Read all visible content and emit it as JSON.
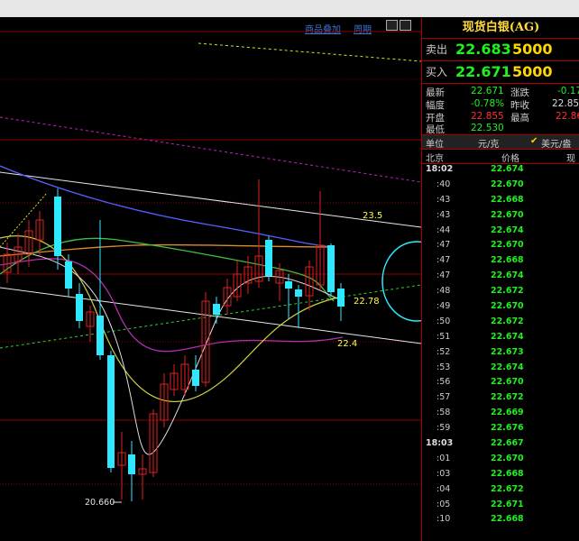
{
  "toolbar": {
    "overlay_label": "商品叠加",
    "period_label": "周期"
  },
  "chart": {
    "annotations": [
      {
        "text": "23.5",
        "color": "#ffff40"
      },
      {
        "text": "22.78",
        "color": "#ffff40"
      },
      {
        "text": "22.4",
        "color": "#ffff40"
      },
      {
        "text": "20.660",
        "color": "#e0e0e0"
      }
    ]
  },
  "panel": {
    "title": "现货白银(AG)",
    "sell": {
      "label": "卖出",
      "price": "22.683",
      "volume": "5000"
    },
    "buy": {
      "label": "买入",
      "price": "22.671",
      "volume": "5000"
    },
    "stats": {
      "latest_label": "最新",
      "latest": "22.671",
      "change_label": "涨跌",
      "change": "-0.17",
      "amplitude_label": "幅度",
      "amplitude": "-0.78%",
      "prev_close_label": "昨收",
      "prev_close": "22.85",
      "open_label": "开盘",
      "open": "22.855",
      "high_label": "最高",
      "high": "22.86",
      "low_label": "最低",
      "low": "22.530"
    },
    "unit_row": {
      "unit_label": "单位",
      "unit": "元/克",
      "alt_unit": "美元/盎"
    },
    "tick_header": {
      "time": "北京",
      "price": "价格",
      "vol": "现"
    },
    "ticks": [
      {
        "time": "18:02",
        "price": "22.674"
      },
      {
        "time": ":40",
        "price": "22.670"
      },
      {
        "time": ":43",
        "price": "22.668"
      },
      {
        "time": ":43",
        "price": "22.670"
      },
      {
        "time": ":44",
        "price": "22.674"
      },
      {
        "time": ":47",
        "price": "22.670"
      },
      {
        "time": ":47",
        "price": "22.668"
      },
      {
        "time": ":47",
        "price": "22.674"
      },
      {
        "time": ":48",
        "price": "22.672"
      },
      {
        "time": ":49",
        "price": "22.670"
      },
      {
        "time": ":50",
        "price": "22.672"
      },
      {
        "time": ":51",
        "price": "22.674"
      },
      {
        "time": ":52",
        "price": "22.673"
      },
      {
        "time": ":53",
        "price": "22.674"
      },
      {
        "time": ":56",
        "price": "22.670"
      },
      {
        "time": ":57",
        "price": "22.672"
      },
      {
        "time": ":58",
        "price": "22.669"
      },
      {
        "time": ":59",
        "price": "22.676"
      },
      {
        "time": "18:03",
        "price": "22.667"
      },
      {
        "time": ":01",
        "price": "22.670"
      },
      {
        "time": ":03",
        "price": "22.668"
      },
      {
        "time": ":04",
        "price": "22.672"
      },
      {
        "time": ":05",
        "price": "22.671"
      },
      {
        "time": ":10",
        "price": "22.668"
      }
    ]
  },
  "colors": {
    "up": "#e02020",
    "down": "#2ee8ff",
    "price_green": "#20f020",
    "title_yellow": "#ffdc3c"
  }
}
